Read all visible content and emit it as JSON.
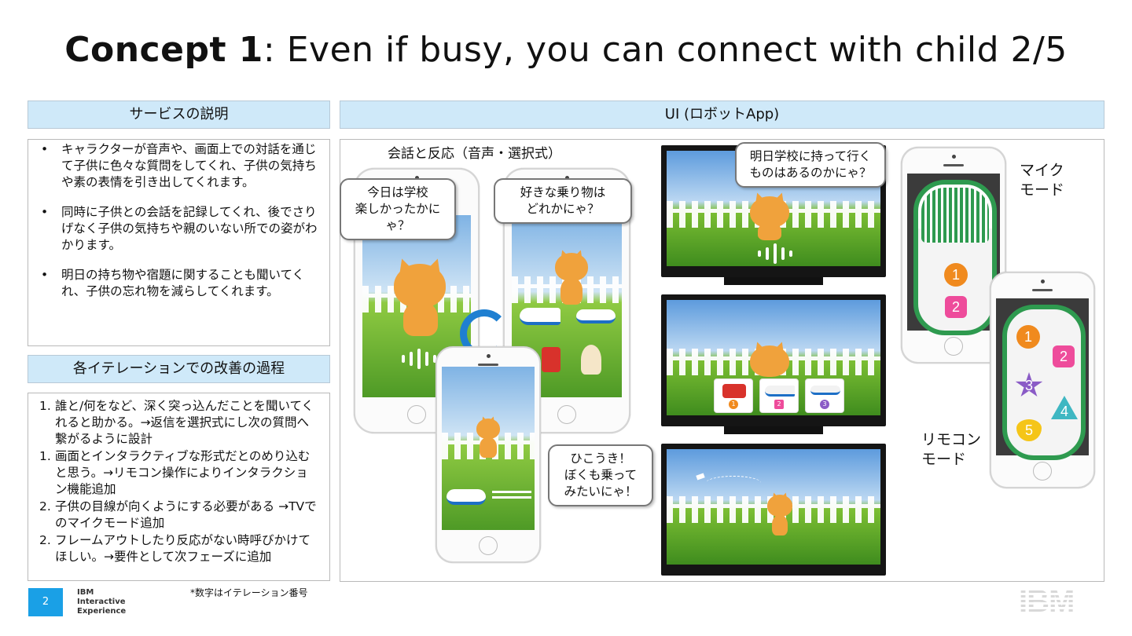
{
  "title": {
    "bold": "Concept 1",
    "rest": ": Even if busy, you can connect with child 2/5"
  },
  "left": {
    "service_header": "サービスの説明",
    "service_bullets": [
      "キャラクターが音声や、画面上での対話を通じて子供に色々な質問をしてくれ、子供の気持ちや素の表情を引き出してくれます。",
      "同時に子供との会話を記録してくれ、後でさりげなく子供の気持ちや親のいない所での姿がわかります。",
      "明日の持ち物や宿題に関することも聞いてくれ、子供の忘れ物を減らしてくれます。"
    ],
    "iteration_header": "各イテレーションでの改善の過程",
    "iterations": [
      {
        "num": "1.",
        "text": "誰と/何をなど、深く突っ込んだことを聞いてくれると助かる。→返信を選択式にし次の質問へ繋がるように設計"
      },
      {
        "num": "1.",
        "text": "画面とインタラクティブな形式だとのめり込むと思う。→リモコン操作によりインタラクション機能追加"
      },
      {
        "num": "2.",
        "text": "子供の目線が向くようにする必要がある →TVでのマイクモード追加"
      },
      {
        "num": "2.",
        "text": "フレームアウトしたり反応がない時呼びかけてほしい。→要件として次フェーズに追加"
      }
    ]
  },
  "right": {
    "ui_header": "UI (ロボットApp)",
    "conversation_label": "会話と反応（音声・選択式）",
    "bubble_school": "今日は学校\n楽しかったかにゃ？",
    "bubble_vehicle": "好きな乗り物は\nどれかにゃ？",
    "bubble_plane": "ひこうき！\nぼくも乗って\nみたいにゃ！",
    "bubble_tomorrow": "明日学校に持って行く\nものはあるのかにゃ？",
    "mic_mode_label": "マイク\nモード",
    "remote_mode_label": "リモコン\nモード",
    "remote_buttons": [
      "1",
      "2",
      "3",
      "4",
      "5"
    ],
    "tv_choice_numbers": [
      "1",
      "2",
      "3"
    ]
  },
  "footer": {
    "page_number": "2",
    "brand_line1": "IBM",
    "brand_line2": "Interactive",
    "brand_line3": "Experience",
    "note": "*数字はイテレーション番号",
    "logo": "IBM"
  },
  "colors": {
    "header_bg": "#cfe9f9",
    "accent_blue": "#1aa0e6",
    "remote_green": "#2e9a4f",
    "button_orange": "#f08a1e",
    "button_pink": "#ee4c9b",
    "star_purple": "#8a5bc6",
    "triangle_teal": "#3fb7c2",
    "heart_yellow": "#f5c518"
  }
}
